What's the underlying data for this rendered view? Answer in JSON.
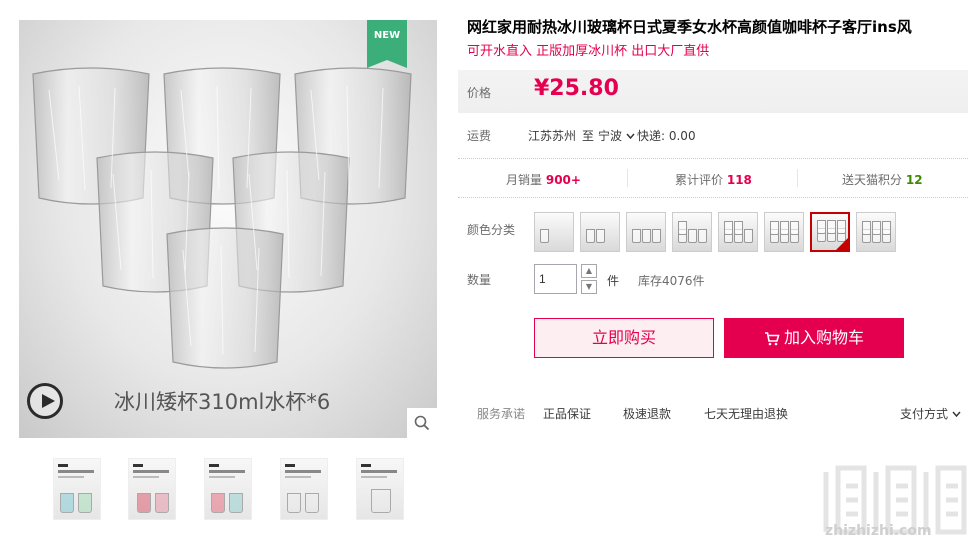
{
  "product": {
    "title": "网红家用耐热冰川玻璃杯日式夏季女水杯高颜值咖啡杯子客厅ins风",
    "subtitle": "可开水直入 正版加厚冰川杯 出口大厂直供",
    "new_badge": "NEW",
    "caption": "冰川矮杯310ml水杯*6"
  },
  "price": {
    "label": "价格",
    "value": "¥25.80"
  },
  "shipping": {
    "label": "运费",
    "from": "江苏苏州",
    "to_word": "至",
    "to": "宁波",
    "express": "快递: 0.00"
  },
  "stats": {
    "monthly_sales_label": "月销量",
    "monthly_sales_value": "900+",
    "reviews_label": "累计评价",
    "reviews_value": "118",
    "points_label": "送天猫积分",
    "points_value": "12"
  },
  "color": {
    "label": "颜色分类",
    "selected_index": 6,
    "options_count": 8
  },
  "quantity": {
    "label": "数量",
    "value": "1",
    "unit": "件",
    "stock": "库存4076件"
  },
  "actions": {
    "buy_now": "立即购买",
    "add_cart": "加入购物车"
  },
  "promises": {
    "label": "服务承诺",
    "items": [
      "正品保证",
      "极速退款",
      "七天无理由退换"
    ],
    "payment": "支付方式"
  },
  "watermark": {
    "text": "zhizhizhi.com"
  },
  "colors": {
    "accent": "#e5004f",
    "badge": "#3cae7a",
    "points": "#3e8a00"
  },
  "icons": [
    "play-icon",
    "search-icon",
    "cart-icon",
    "chevron-down-icon"
  ]
}
